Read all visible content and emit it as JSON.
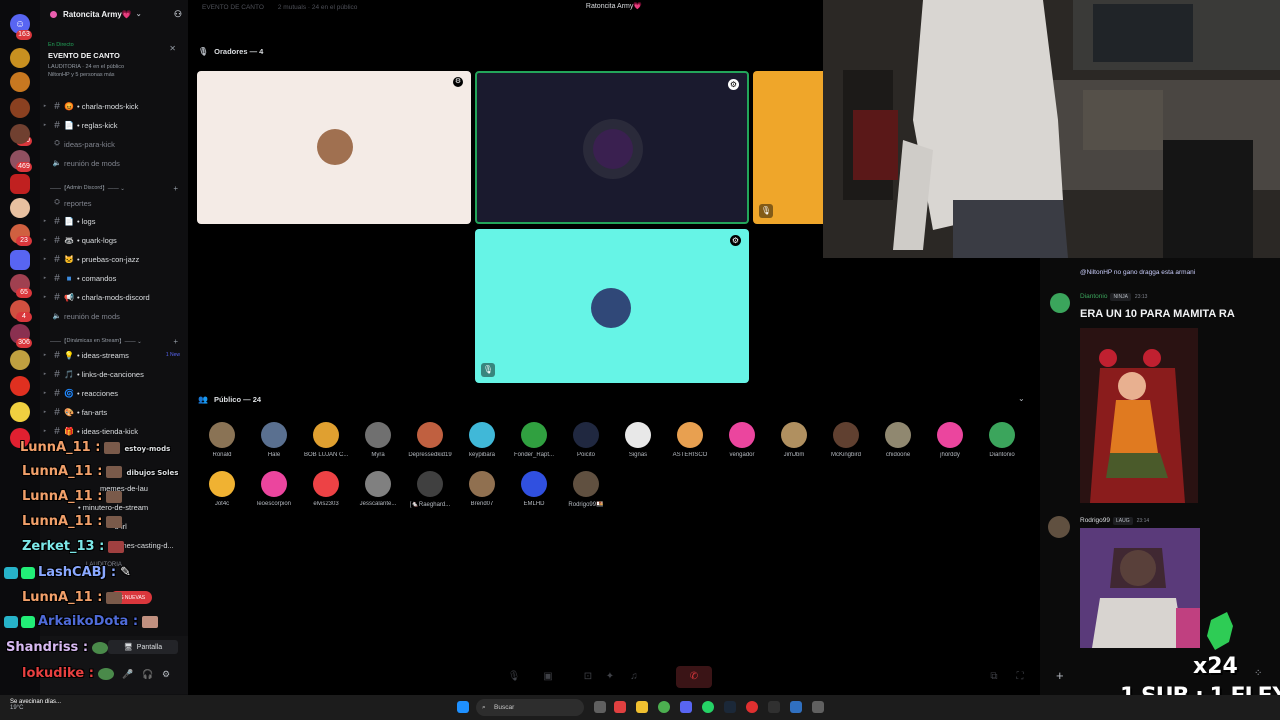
{
  "window": {
    "title": "Ratoncita Army💗"
  },
  "rail": {
    "badges": [
      "163",
      "120",
      "469",
      "23",
      "65",
      "4",
      "306"
    ]
  },
  "server": {
    "name": "Ratoncita Army💗",
    "stage": {
      "status": "En Directo",
      "title": "EVENTO DE CANTO",
      "meta": "LAUDITORIA · 24 en el público",
      "meta2": "NiltonHP y 5 personas más"
    },
    "channels": [
      {
        "name": "charla-mods-kick",
        "emoji": "😡"
      },
      {
        "name": "reglas-kick",
        "emoji": "📄"
      },
      {
        "name": "ideas-para-kick",
        "muted": true
      },
      {
        "name": "reunión de mods",
        "voice": true
      },
      {
        "name": "reportes",
        "muted": true
      },
      {
        "name": "logs",
        "emoji": "📄"
      },
      {
        "name": "quark-logs",
        "emoji": "🦝"
      },
      {
        "name": "pruebas-con-jazz",
        "emoji": "🐱"
      },
      {
        "name": "comandos",
        "emoji": "🟦"
      },
      {
        "name": "charla-mods-discord",
        "emoji": "📢"
      },
      {
        "name": "reunión de mods",
        "voice": true
      },
      {
        "name": "ideas-streams",
        "emoji": "💡",
        "tag": "1 New"
      },
      {
        "name": "links-de-canciones",
        "emoji": "🎵"
      },
      {
        "name": "reacciones",
        "emoji": "🌀"
      },
      {
        "name": "fan-arts",
        "emoji": "🎨"
      },
      {
        "name": "ideas-tienda-kick",
        "emoji": "🎁"
      },
      {
        "name": "memes-de-lau"
      },
      {
        "name": "minutero-de-stream"
      },
      {
        "name": "s-irl"
      },
      {
        "name": "memes-casting-d..."
      }
    ],
    "categories": [
      "Admin Discord",
      "Dinámicas en Stream"
    ],
    "nuevas_label": "ES NUEVAS",
    "voice_status": "LAUDITORIA",
    "screen_label": "Pantalla"
  },
  "overlay_chat": [
    {
      "user": "LunnA_11",
      "color": "#f2a06a"
    },
    {
      "user": "LunnA_11",
      "color": "#f2a06a"
    },
    {
      "user": "LunnA_11",
      "color": "#f2a06a"
    },
    {
      "user": "LunnA_11",
      "color": "#f2a06a"
    },
    {
      "user": "Zerket_13",
      "color": "#7ce8e8"
    },
    {
      "user": "LashCABJ",
      "color": "#8aa8ff"
    },
    {
      "user": "LunnA_11",
      "color": "#f2a06a"
    },
    {
      "user": "ArkaikoDota",
      "color": "#4f6bd8"
    },
    {
      "user": "Shandriss",
      "color": "#d6b8f0"
    },
    {
      "user": "lokudike",
      "color": "#e84040"
    }
  ],
  "overlay_fragments": [
    "estoy-mods",
    "dibujos",
    "Soles"
  ],
  "stage_main": {
    "topbar_title": "EVENTO DE CANTO",
    "topbar_meta": "2 mutuals · 24 en el público",
    "speakers_header": "Oradores — 4",
    "audience_header": "Público — 24",
    "audience": [
      {
        "name": "Ronald",
        "color": "#8a7355"
      },
      {
        "name": "Hale",
        "color": "#5a7090"
      },
      {
        "name": "BOB LUJAN C...",
        "color": "#e0a030"
      },
      {
        "name": "Myra",
        "color": "#707070"
      },
      {
        "name": "Depressedkid19",
        "color": "#c06040"
      },
      {
        "name": "keypibara",
        "color": "#40b8d8"
      },
      {
        "name": "Fonder_Rapt...",
        "color": "#30a040"
      },
      {
        "name": "Poicito",
        "color": "#202840"
      },
      {
        "name": "Signas",
        "color": "#e8e8e8"
      },
      {
        "name": "ASTERISCO",
        "color": "#e8a050"
      },
      {
        "name": "vengador",
        "color": "#eb459e"
      },
      {
        "name": "JimJbm",
        "color": "#b09060"
      },
      {
        "name": "McKingbird",
        "color": "#604030"
      },
      {
        "name": "chidoone",
        "color": "#908870"
      },
      {
        "name": "jhorddy",
        "color": "#eb459e"
      },
      {
        "name": "Diantonio",
        "color": "#3ba55c"
      },
      {
        "name": "Jot4c",
        "color": "#f0b232"
      },
      {
        "name": "leoescorpion",
        "color": "#eb459e"
      },
      {
        "name": "elvis2303",
        "color": "#ed4245"
      },
      {
        "name": "Jesscalante...",
        "color": "#808080"
      },
      {
        "name": "[🐁Raeghard...",
        "color": "#404040"
      },
      {
        "name": "Brend07",
        "color": "#907050"
      },
      {
        "name": "EMLHD",
        "color": "#3050e0"
      },
      {
        "name": "Rodrigo99🍱",
        "color": "#605040"
      }
    ]
  },
  "chat": {
    "reply_preview": "@NiltonHP no gano dragga esta armani",
    "messages": [
      {
        "user": "Diantonio",
        "role": "NINJA",
        "time": "23:13",
        "text": "ERA UN 10 PARA MAMITA RA",
        "color": "#3ba55c"
      },
      {
        "user": "Rodrigo99",
        "role": "LAUG",
        "time": "23:14",
        "color": "#dbdee1"
      }
    ]
  },
  "stream_overlay": {
    "multiplier": "x24",
    "sub_text": "1 SUB : 1 FLEXIÓN"
  },
  "taskbar": {
    "weather_text": "Se avecinan días...",
    "temperature": "19°C",
    "search_placeholder": "Buscar"
  }
}
